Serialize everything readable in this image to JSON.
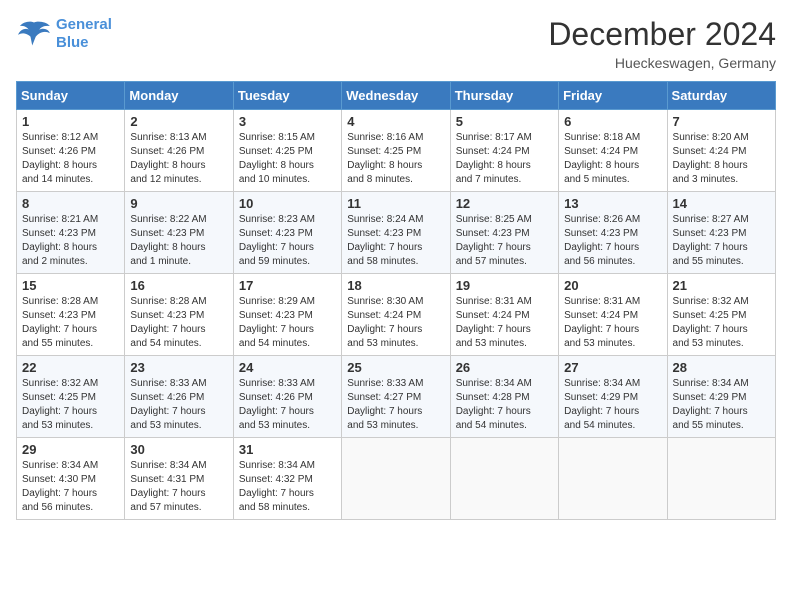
{
  "header": {
    "logo_line1": "General",
    "logo_line2": "Blue",
    "month": "December 2024",
    "location": "Hueckeswagen, Germany"
  },
  "weekdays": [
    "Sunday",
    "Monday",
    "Tuesday",
    "Wednesday",
    "Thursday",
    "Friday",
    "Saturday"
  ],
  "weeks": [
    [
      {
        "day": "1",
        "text": "Sunrise: 8:12 AM\nSunset: 4:26 PM\nDaylight: 8 hours\nand 14 minutes."
      },
      {
        "day": "2",
        "text": "Sunrise: 8:13 AM\nSunset: 4:26 PM\nDaylight: 8 hours\nand 12 minutes."
      },
      {
        "day": "3",
        "text": "Sunrise: 8:15 AM\nSunset: 4:25 PM\nDaylight: 8 hours\nand 10 minutes."
      },
      {
        "day": "4",
        "text": "Sunrise: 8:16 AM\nSunset: 4:25 PM\nDaylight: 8 hours\nand 8 minutes."
      },
      {
        "day": "5",
        "text": "Sunrise: 8:17 AM\nSunset: 4:24 PM\nDaylight: 8 hours\nand 7 minutes."
      },
      {
        "day": "6",
        "text": "Sunrise: 8:18 AM\nSunset: 4:24 PM\nDaylight: 8 hours\nand 5 minutes."
      },
      {
        "day": "7",
        "text": "Sunrise: 8:20 AM\nSunset: 4:24 PM\nDaylight: 8 hours\nand 3 minutes."
      }
    ],
    [
      {
        "day": "8",
        "text": "Sunrise: 8:21 AM\nSunset: 4:23 PM\nDaylight: 8 hours\nand 2 minutes."
      },
      {
        "day": "9",
        "text": "Sunrise: 8:22 AM\nSunset: 4:23 PM\nDaylight: 8 hours\nand 1 minute."
      },
      {
        "day": "10",
        "text": "Sunrise: 8:23 AM\nSunset: 4:23 PM\nDaylight: 7 hours\nand 59 minutes."
      },
      {
        "day": "11",
        "text": "Sunrise: 8:24 AM\nSunset: 4:23 PM\nDaylight: 7 hours\nand 58 minutes."
      },
      {
        "day": "12",
        "text": "Sunrise: 8:25 AM\nSunset: 4:23 PM\nDaylight: 7 hours\nand 57 minutes."
      },
      {
        "day": "13",
        "text": "Sunrise: 8:26 AM\nSunset: 4:23 PM\nDaylight: 7 hours\nand 56 minutes."
      },
      {
        "day": "14",
        "text": "Sunrise: 8:27 AM\nSunset: 4:23 PM\nDaylight: 7 hours\nand 55 minutes."
      }
    ],
    [
      {
        "day": "15",
        "text": "Sunrise: 8:28 AM\nSunset: 4:23 PM\nDaylight: 7 hours\nand 55 minutes."
      },
      {
        "day": "16",
        "text": "Sunrise: 8:28 AM\nSunset: 4:23 PM\nDaylight: 7 hours\nand 54 minutes."
      },
      {
        "day": "17",
        "text": "Sunrise: 8:29 AM\nSunset: 4:23 PM\nDaylight: 7 hours\nand 54 minutes."
      },
      {
        "day": "18",
        "text": "Sunrise: 8:30 AM\nSunset: 4:24 PM\nDaylight: 7 hours\nand 53 minutes."
      },
      {
        "day": "19",
        "text": "Sunrise: 8:31 AM\nSunset: 4:24 PM\nDaylight: 7 hours\nand 53 minutes."
      },
      {
        "day": "20",
        "text": "Sunrise: 8:31 AM\nSunset: 4:24 PM\nDaylight: 7 hours\nand 53 minutes."
      },
      {
        "day": "21",
        "text": "Sunrise: 8:32 AM\nSunset: 4:25 PM\nDaylight: 7 hours\nand 53 minutes."
      }
    ],
    [
      {
        "day": "22",
        "text": "Sunrise: 8:32 AM\nSunset: 4:25 PM\nDaylight: 7 hours\nand 53 minutes."
      },
      {
        "day": "23",
        "text": "Sunrise: 8:33 AM\nSunset: 4:26 PM\nDaylight: 7 hours\nand 53 minutes."
      },
      {
        "day": "24",
        "text": "Sunrise: 8:33 AM\nSunset: 4:26 PM\nDaylight: 7 hours\nand 53 minutes."
      },
      {
        "day": "25",
        "text": "Sunrise: 8:33 AM\nSunset: 4:27 PM\nDaylight: 7 hours\nand 53 minutes."
      },
      {
        "day": "26",
        "text": "Sunrise: 8:34 AM\nSunset: 4:28 PM\nDaylight: 7 hours\nand 54 minutes."
      },
      {
        "day": "27",
        "text": "Sunrise: 8:34 AM\nSunset: 4:29 PM\nDaylight: 7 hours\nand 54 minutes."
      },
      {
        "day": "28",
        "text": "Sunrise: 8:34 AM\nSunset: 4:29 PM\nDaylight: 7 hours\nand 55 minutes."
      }
    ],
    [
      {
        "day": "29",
        "text": "Sunrise: 8:34 AM\nSunset: 4:30 PM\nDaylight: 7 hours\nand 56 minutes."
      },
      {
        "day": "30",
        "text": "Sunrise: 8:34 AM\nSunset: 4:31 PM\nDaylight: 7 hours\nand 57 minutes."
      },
      {
        "day": "31",
        "text": "Sunrise: 8:34 AM\nSunset: 4:32 PM\nDaylight: 7 hours\nand 58 minutes."
      },
      {
        "day": "",
        "text": ""
      },
      {
        "day": "",
        "text": ""
      },
      {
        "day": "",
        "text": ""
      },
      {
        "day": "",
        "text": ""
      }
    ]
  ]
}
